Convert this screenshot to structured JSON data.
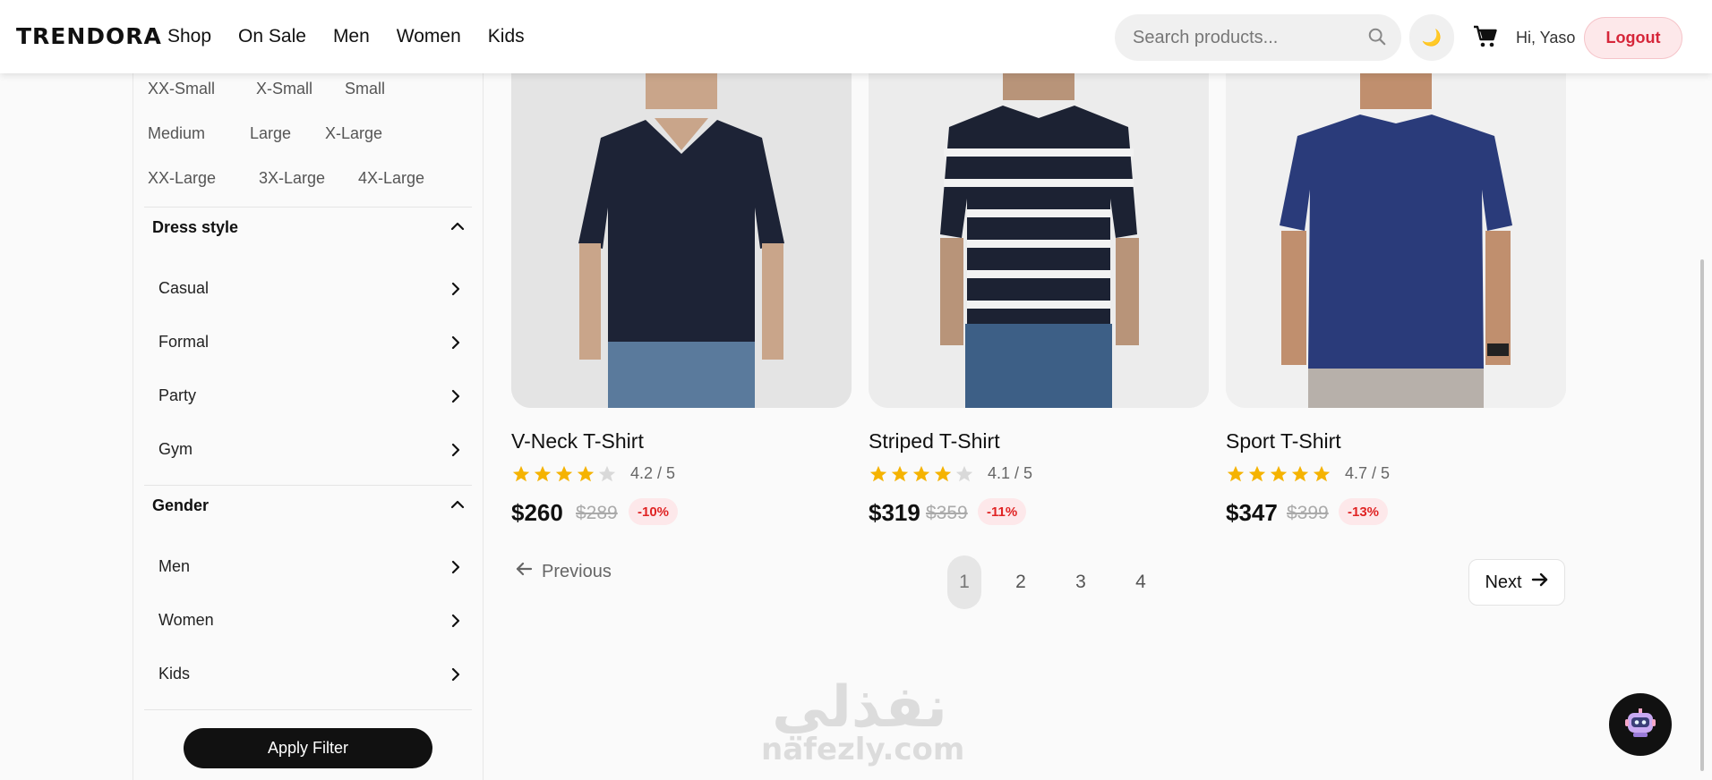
{
  "header": {
    "logo": "TRENDORA",
    "nav": [
      "Shop",
      "On Sale",
      "Men",
      "Women",
      "Kids"
    ],
    "search_placeholder": "Search products...",
    "theme_icon": "🌙",
    "greeting": "Hi, Yaso",
    "logout_label": "Logout"
  },
  "sidebar": {
    "sizes": [
      "XX-Small",
      "X-Small",
      "Small",
      "Medium",
      "Large",
      "X-Large",
      "XX-Large",
      "3X-Large",
      "4X-Large"
    ],
    "dress_style": {
      "title": "Dress style",
      "items": [
        "Casual",
        "Formal",
        "Party",
        "Gym"
      ]
    },
    "gender": {
      "title": "Gender",
      "items": [
        "Men",
        "Women",
        "Kids"
      ]
    },
    "apply_label": "Apply Filter"
  },
  "products": [
    {
      "name": "V-Neck T-Shirt",
      "rating": 4.2,
      "rating_text": "4.2 / 5",
      "price": "$260",
      "old_price": "$289",
      "discount": "-10%"
    },
    {
      "name": "Striped T-Shirt",
      "rating": 4.1,
      "rating_text": "4.1 / 5",
      "price": "$319",
      "old_price": "$359",
      "discount": "-11%"
    },
    {
      "name": "Sport T-Shirt",
      "rating": 4.7,
      "rating_text": "4.7 / 5",
      "price": "$347",
      "old_price": "$399",
      "discount": "-13%"
    }
  ],
  "pagination": {
    "previous_label": "Previous",
    "pages": [
      "1",
      "2",
      "3",
      "4"
    ],
    "current_page": "1",
    "next_label": "Next"
  },
  "watermark": {
    "arabic": "نفذلي",
    "latin": "nafezly.com"
  },
  "colors": {
    "star": "#f5b301",
    "discount_bg": "#fde8ea",
    "discount_text": "#e02424",
    "logout_text": "#d6263a"
  }
}
